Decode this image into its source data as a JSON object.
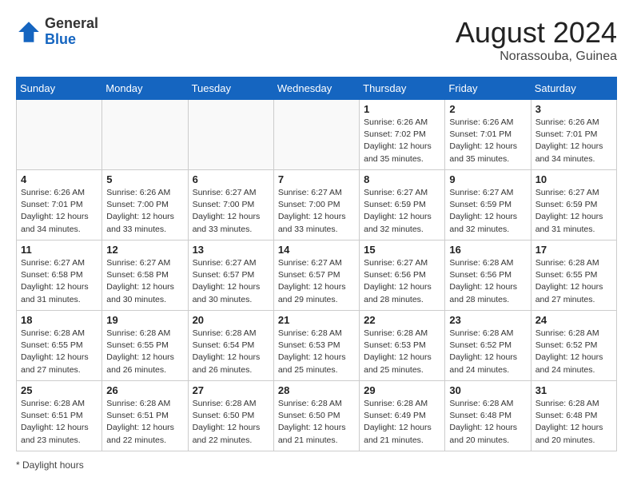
{
  "header": {
    "logo_general": "General",
    "logo_blue": "Blue",
    "month_year": "August 2024",
    "location": "Norassouba, Guinea"
  },
  "days_of_week": [
    "Sunday",
    "Monday",
    "Tuesday",
    "Wednesday",
    "Thursday",
    "Friday",
    "Saturday"
  ],
  "footer": {
    "label": "Daylight hours"
  },
  "weeks": [
    [
      {
        "day": "",
        "sunrise": "",
        "sunset": "",
        "daylight": ""
      },
      {
        "day": "",
        "sunrise": "",
        "sunset": "",
        "daylight": ""
      },
      {
        "day": "",
        "sunrise": "",
        "sunset": "",
        "daylight": ""
      },
      {
        "day": "",
        "sunrise": "",
        "sunset": "",
        "daylight": ""
      },
      {
        "day": "1",
        "sunrise": "Sunrise: 6:26 AM",
        "sunset": "Sunset: 7:02 PM",
        "daylight": "Daylight: 12 hours and 35 minutes."
      },
      {
        "day": "2",
        "sunrise": "Sunrise: 6:26 AM",
        "sunset": "Sunset: 7:01 PM",
        "daylight": "Daylight: 12 hours and 35 minutes."
      },
      {
        "day": "3",
        "sunrise": "Sunrise: 6:26 AM",
        "sunset": "Sunset: 7:01 PM",
        "daylight": "Daylight: 12 hours and 34 minutes."
      }
    ],
    [
      {
        "day": "4",
        "sunrise": "Sunrise: 6:26 AM",
        "sunset": "Sunset: 7:01 PM",
        "daylight": "Daylight: 12 hours and 34 minutes."
      },
      {
        "day": "5",
        "sunrise": "Sunrise: 6:26 AM",
        "sunset": "Sunset: 7:00 PM",
        "daylight": "Daylight: 12 hours and 33 minutes."
      },
      {
        "day": "6",
        "sunrise": "Sunrise: 6:27 AM",
        "sunset": "Sunset: 7:00 PM",
        "daylight": "Daylight: 12 hours and 33 minutes."
      },
      {
        "day": "7",
        "sunrise": "Sunrise: 6:27 AM",
        "sunset": "Sunset: 7:00 PM",
        "daylight": "Daylight: 12 hours and 33 minutes."
      },
      {
        "day": "8",
        "sunrise": "Sunrise: 6:27 AM",
        "sunset": "Sunset: 6:59 PM",
        "daylight": "Daylight: 12 hours and 32 minutes."
      },
      {
        "day": "9",
        "sunrise": "Sunrise: 6:27 AM",
        "sunset": "Sunset: 6:59 PM",
        "daylight": "Daylight: 12 hours and 32 minutes."
      },
      {
        "day": "10",
        "sunrise": "Sunrise: 6:27 AM",
        "sunset": "Sunset: 6:59 PM",
        "daylight": "Daylight: 12 hours and 31 minutes."
      }
    ],
    [
      {
        "day": "11",
        "sunrise": "Sunrise: 6:27 AM",
        "sunset": "Sunset: 6:58 PM",
        "daylight": "Daylight: 12 hours and 31 minutes."
      },
      {
        "day": "12",
        "sunrise": "Sunrise: 6:27 AM",
        "sunset": "Sunset: 6:58 PM",
        "daylight": "Daylight: 12 hours and 30 minutes."
      },
      {
        "day": "13",
        "sunrise": "Sunrise: 6:27 AM",
        "sunset": "Sunset: 6:57 PM",
        "daylight": "Daylight: 12 hours and 30 minutes."
      },
      {
        "day": "14",
        "sunrise": "Sunrise: 6:27 AM",
        "sunset": "Sunset: 6:57 PM",
        "daylight": "Daylight: 12 hours and 29 minutes."
      },
      {
        "day": "15",
        "sunrise": "Sunrise: 6:27 AM",
        "sunset": "Sunset: 6:56 PM",
        "daylight": "Daylight: 12 hours and 28 minutes."
      },
      {
        "day": "16",
        "sunrise": "Sunrise: 6:28 AM",
        "sunset": "Sunset: 6:56 PM",
        "daylight": "Daylight: 12 hours and 28 minutes."
      },
      {
        "day": "17",
        "sunrise": "Sunrise: 6:28 AM",
        "sunset": "Sunset: 6:55 PM",
        "daylight": "Daylight: 12 hours and 27 minutes."
      }
    ],
    [
      {
        "day": "18",
        "sunrise": "Sunrise: 6:28 AM",
        "sunset": "Sunset: 6:55 PM",
        "daylight": "Daylight: 12 hours and 27 minutes."
      },
      {
        "day": "19",
        "sunrise": "Sunrise: 6:28 AM",
        "sunset": "Sunset: 6:55 PM",
        "daylight": "Daylight: 12 hours and 26 minutes."
      },
      {
        "day": "20",
        "sunrise": "Sunrise: 6:28 AM",
        "sunset": "Sunset: 6:54 PM",
        "daylight": "Daylight: 12 hours and 26 minutes."
      },
      {
        "day": "21",
        "sunrise": "Sunrise: 6:28 AM",
        "sunset": "Sunset: 6:53 PM",
        "daylight": "Daylight: 12 hours and 25 minutes."
      },
      {
        "day": "22",
        "sunrise": "Sunrise: 6:28 AM",
        "sunset": "Sunset: 6:53 PM",
        "daylight": "Daylight: 12 hours and 25 minutes."
      },
      {
        "day": "23",
        "sunrise": "Sunrise: 6:28 AM",
        "sunset": "Sunset: 6:52 PM",
        "daylight": "Daylight: 12 hours and 24 minutes."
      },
      {
        "day": "24",
        "sunrise": "Sunrise: 6:28 AM",
        "sunset": "Sunset: 6:52 PM",
        "daylight": "Daylight: 12 hours and 24 minutes."
      }
    ],
    [
      {
        "day": "25",
        "sunrise": "Sunrise: 6:28 AM",
        "sunset": "Sunset: 6:51 PM",
        "daylight": "Daylight: 12 hours and 23 minutes."
      },
      {
        "day": "26",
        "sunrise": "Sunrise: 6:28 AM",
        "sunset": "Sunset: 6:51 PM",
        "daylight": "Daylight: 12 hours and 22 minutes."
      },
      {
        "day": "27",
        "sunrise": "Sunrise: 6:28 AM",
        "sunset": "Sunset: 6:50 PM",
        "daylight": "Daylight: 12 hours and 22 minutes."
      },
      {
        "day": "28",
        "sunrise": "Sunrise: 6:28 AM",
        "sunset": "Sunset: 6:50 PM",
        "daylight": "Daylight: 12 hours and 21 minutes."
      },
      {
        "day": "29",
        "sunrise": "Sunrise: 6:28 AM",
        "sunset": "Sunset: 6:49 PM",
        "daylight": "Daylight: 12 hours and 21 minutes."
      },
      {
        "day": "30",
        "sunrise": "Sunrise: 6:28 AM",
        "sunset": "Sunset: 6:48 PM",
        "daylight": "Daylight: 12 hours and 20 minutes."
      },
      {
        "day": "31",
        "sunrise": "Sunrise: 6:28 AM",
        "sunset": "Sunset: 6:48 PM",
        "daylight": "Daylight: 12 hours and 20 minutes."
      }
    ]
  ]
}
